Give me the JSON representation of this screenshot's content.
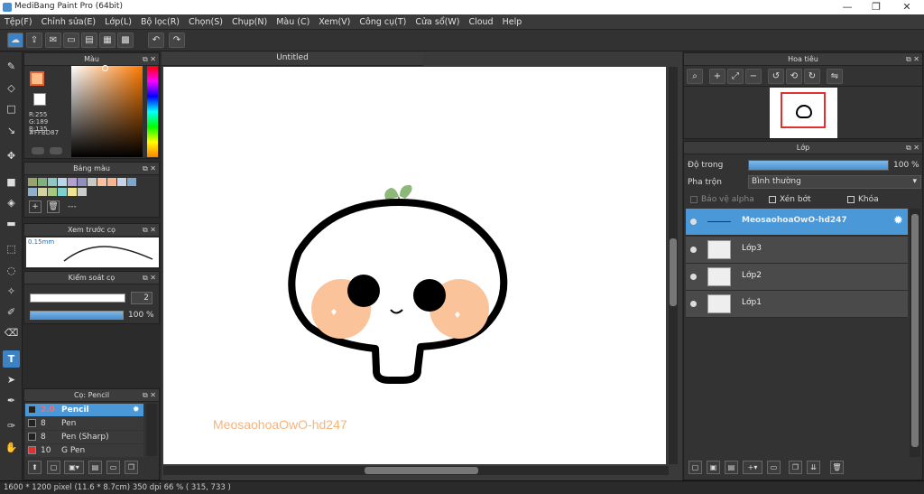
{
  "window": {
    "title": "MediBang Paint Pro (64bit)",
    "minimize": "—",
    "maximize": "❐",
    "close": "✕"
  },
  "menu": [
    "Tệp(F)",
    "Chỉnh sửa(E)",
    "Lớp(L)",
    "Bộ lọc(R)",
    "Chọn(S)",
    "Chụp(N)",
    "Màu (C)",
    "Xem(V)",
    "Công cụ(T)",
    "Cửa sổ(W)",
    "Cloud",
    "Help"
  ],
  "color_panel": {
    "title": "Màu",
    "r": "R:255",
    "g": "G:189",
    "b": "B:135",
    "hex": "#FFBD87",
    "primary": "#FFBD87"
  },
  "palette_panel": {
    "title": "Bảng màu",
    "more": "---",
    "swatches": [
      "#9aa36b",
      "#7fb07f",
      "#8fc7c3",
      "#b7d6ea",
      "#b2a1d1",
      "#8f8fc0",
      "#c8c8c8",
      "#f7c0a0",
      "#f7b48f",
      "#c6d4ea",
      "#7fa6c9",
      "#8fb0cc",
      "#d3d3a0",
      "#a8c87f",
      "#7ed0d0",
      "#f0e58f",
      "#cccccc"
    ]
  },
  "brush_preview": {
    "title": "Xem trước cọ",
    "size": "0.15mm"
  },
  "brush_control": {
    "title": "Kiểm soát cọ",
    "size": "2",
    "opacity": "100 %"
  },
  "brush_list": {
    "title": "Cọ: Pencil",
    "items": [
      {
        "size": "2.0",
        "name": "Pencil",
        "color": "#222222"
      },
      {
        "size": "8",
        "name": "Pen",
        "color": "#222222"
      },
      {
        "size": "8",
        "name": "Pen (Sharp)",
        "color": "#222222"
      },
      {
        "size": "10",
        "name": "G Pen",
        "color": "#e03030"
      }
    ]
  },
  "canvas": {
    "tab": "Untitled",
    "watermark": "MeosaohoaOwO-hd247"
  },
  "navigator": {
    "title": "Hoa tiêu"
  },
  "layer_panel": {
    "title": "Lớp",
    "opacity_label": "Độ trong",
    "opacity_value": "100 %",
    "opacity_fraction": 1.0,
    "blend_label": "Pha trộn",
    "blend_value": "Bình thường",
    "protect_alpha": "Bảo vệ alpha",
    "clipping": "Xén bớt",
    "lock": "Khóa",
    "layers": [
      {
        "name": "MeosaohoaOwO-hd247",
        "selected": true
      },
      {
        "name": "Lớp3",
        "selected": false
      },
      {
        "name": "Lớp2",
        "selected": false
      },
      {
        "name": "Lớp1",
        "selected": false
      }
    ]
  },
  "status": {
    "text": "1600 * 1200 pixel   (11.6 * 8.7cm)   350 dpi   66 %   ( 315, 733 )"
  }
}
